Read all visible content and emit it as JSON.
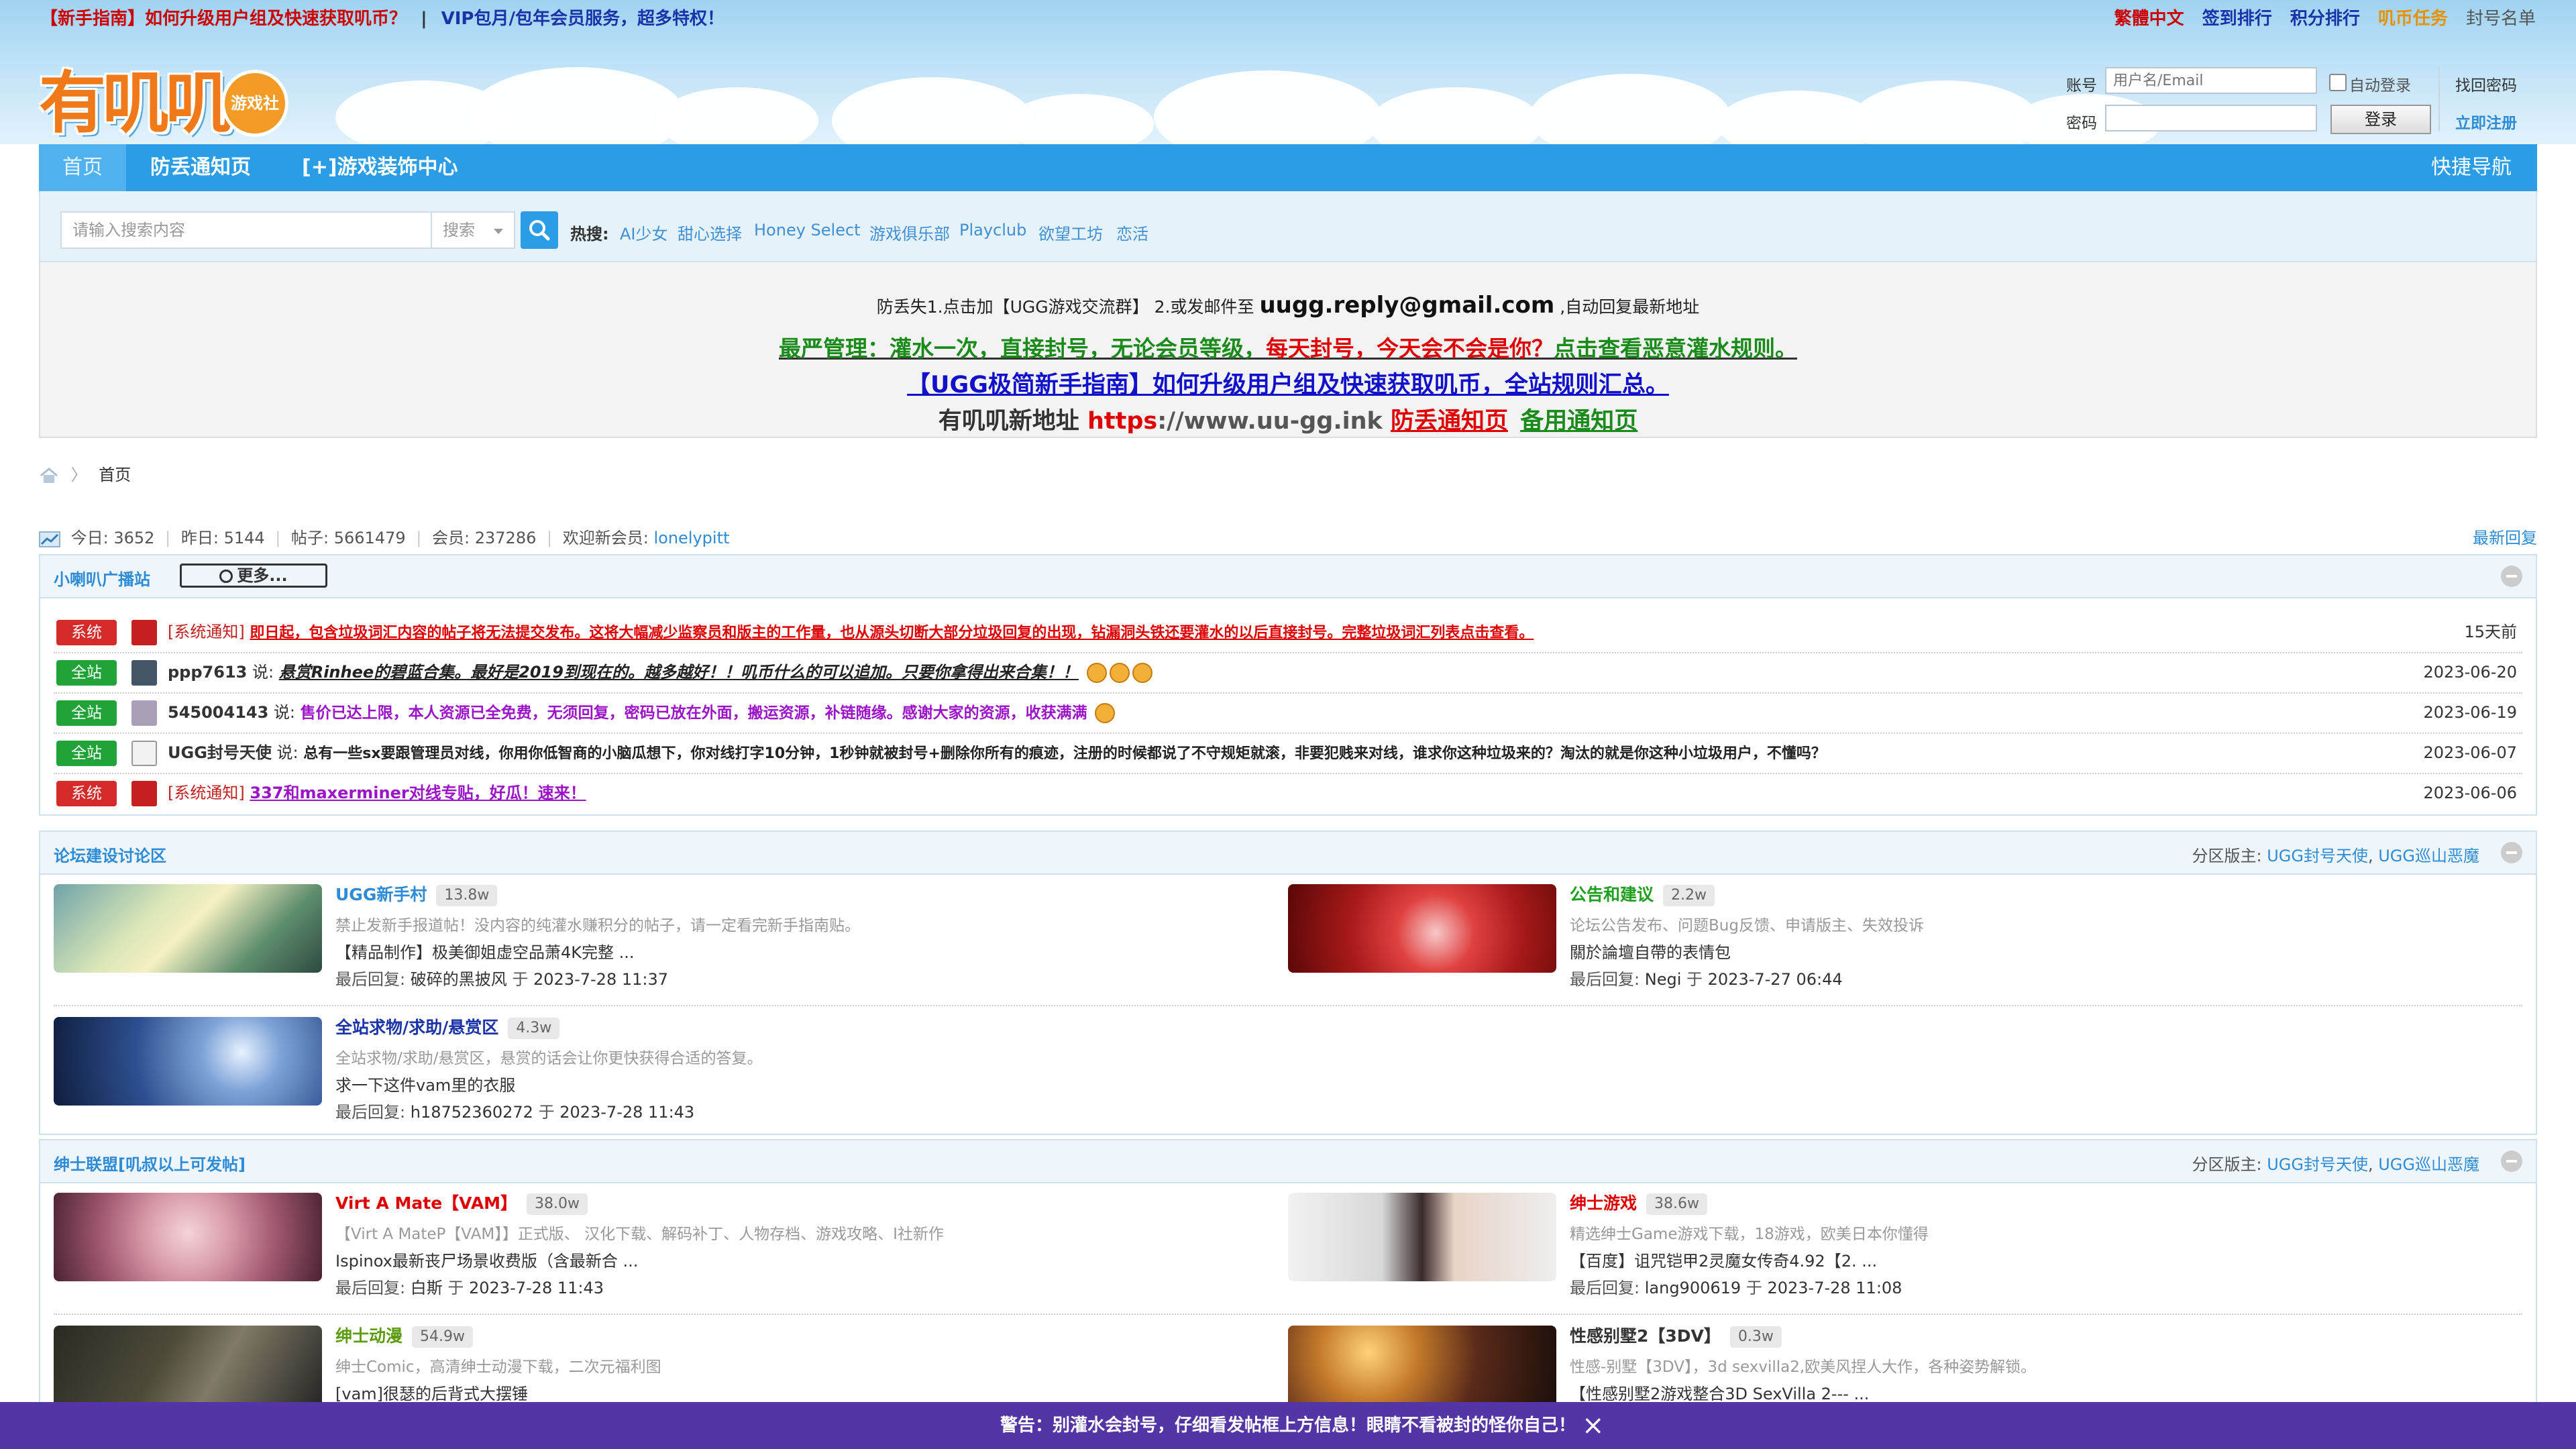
{
  "topbar": {
    "link1": "【新手指南】如何升级用户组及快速获取叽币？",
    "separator": "|",
    "link2": "VIP包月/包年会员服务，超多特权！",
    "right_links": [
      {
        "label": "繁體中文",
        "color": "#cc0000"
      },
      {
        "label": "签到排行",
        "color": "#1b33a8"
      },
      {
        "label": "积分排行",
        "color": "#1b33a8"
      },
      {
        "label": "叽币任务",
        "color": "#e69100"
      },
      {
        "label": "封号名单",
        "color": "#555555"
      }
    ]
  },
  "logo": {
    "text": "有叽叽",
    "badge": "游戏社"
  },
  "login": {
    "account_label": "账号",
    "account_placeholder": "用户名/Email",
    "auto_login": "自动登录",
    "find_password": "找回密码",
    "password_label": "密码",
    "login_button": "登录",
    "register": "立即注册"
  },
  "nav": {
    "items": [
      "首页",
      "防丢通知页",
      "[+]游戏装饰中心"
    ],
    "quick": "快捷导航"
  },
  "search": {
    "placeholder": "请输入搜索内容",
    "select": "搜索",
    "hot_label": "热搜:",
    "hot": [
      "AI少女",
      "甜心选择",
      "Honey Select",
      "游戏俱乐部",
      "Playclub",
      "欲望工坊",
      "恋活"
    ]
  },
  "announce": {
    "line1_pre": "防丢失1.点击加【UGG游戏交流群】 2.或发邮件至",
    "line1_email": "uugg.reply@gmail.com",
    "line1_post": ",自动回复最新地址",
    "line2_a": "最严管理：灌水一次，直接封号，无论会员等级，",
    "line2_b": "每天封号，今天会不会是你？",
    "line2_c": "点击查看恶意灌水规则。",
    "line3": "【UGG极简新手指南】如何升级用户组及快速获取叽币，全站规则汇总。",
    "line4_a": "有叽叽新地址 ",
    "line4_b": "https",
    "line4_c": "://www.uu-gg.ink ",
    "line4_d": "防丢通知页",
    "line4_e": "备用通知页"
  },
  "breadcrumb": {
    "home": "首页"
  },
  "stats": {
    "today_label": "今日:",
    "today": "3652",
    "yesterday_label": "昨日:",
    "yesterday": "5144",
    "posts_label": "帖子:",
    "posts": "5661479",
    "members_label": "会员:",
    "members": "237286",
    "welcome_label": "欢迎新会员:",
    "newest": "lonelypitt",
    "latest_reply": "最新回复"
  },
  "broadcast": {
    "title": "小喇叭广播站",
    "more": "更多...",
    "rows": [
      {
        "tag": "系统",
        "user": "[系统通知]",
        "said": "",
        "text": "即日起，包含垃圾词汇内容的帖子将无法提交发布。这将大幅减少监察员和版主的工作量，也从源头切断大部分垃圾回复的出现，钻漏洞头铁还要灌水的以后直接封号。完整垃圾词汇列表点击查看。",
        "date": "15天前"
      },
      {
        "tag": "全站",
        "user": "ppp7613",
        "said": "说:",
        "text": "悬赏Rinhee的碧蓝合集。最好是2019到现在的。越多越好！！叽币什么的可以追加。只要你拿得出来合集！！",
        "date": "2023-06-20"
      },
      {
        "tag": "全站",
        "user": "545004143",
        "said": "说:",
        "text": "售价已达上限，本人资源已全免费，无须回复，密码已放在外面，搬运资源，补链随缘。感谢大家的资源，收获满满",
        "date": "2023-06-19"
      },
      {
        "tag": "全站",
        "user": "UGG封号天使",
        "said": "说:",
        "text": "总有一些sx要跟管理员对线，你用你低智商的小脑瓜想下，你对线打字10分钟，1秒钟就被封号+删除你所有的痕迹，注册的时候都说了不守规矩就滚，非要犯贱来对线，谁求你这种垃圾来的？淘汰的就是你这种小垃圾用户，不懂吗？",
        "date": "2023-06-07"
      },
      {
        "tag": "系统",
        "user": "[系统通知]",
        "said": "",
        "text": "337和maxerminer对线专贴，好瓜！速来！",
        "date": "2023-06-06"
      }
    ]
  },
  "section1": {
    "title": "论坛建设讨论区",
    "mods_label": "分区版主:",
    "mods": [
      "UGG封号天使",
      "UGG巡山恶魔"
    ],
    "forums": [
      {
        "name": "UGG新手村",
        "count": "13.8w",
        "desc": "禁止发新手报道帖！没内容的纯灌水赚积分的帖子，请一定看完新手指南贴。",
        "last": "【精品制作】极美御姐虚空品萧4K完整 ...",
        "last_reply_label": "最后回复:",
        "last_user": "破碎的黑披风",
        "at": "于",
        "time": "2023-7-28 11:37"
      },
      {
        "name": "公告和建议",
        "count": "2.2w",
        "desc": "论坛公告发布、问题Bug反馈、申请版主、失效投诉",
        "last": "關於論壇自帶的表情包",
        "last_reply_label": "最后回复:",
        "last_user": "Negi",
        "at": "于",
        "time": "2023-7-27 06:44"
      },
      {
        "name": "全站求物/求助/悬赏区",
        "count": "4.3w",
        "desc": "全站求物/求助/悬赏区，悬赏的话会让你更快获得合适的答复。",
        "last": "求一下这件vam里的衣服",
        "last_reply_label": "最后回复:",
        "last_user": "h18752360272",
        "at": "于",
        "time": "2023-7-28 11:43"
      }
    ]
  },
  "section2": {
    "title": "绅士联盟[叽叔以上可发帖]",
    "mods_label": "分区版主:",
    "mods": [
      "UGG封号天使",
      "UGG巡山恶魔"
    ],
    "forums": [
      {
        "name": "Virt A Mate【VAM】",
        "count": "38.0w",
        "desc": "【Virt A MateP【VAM】】正式版、 汉化下载、解码补丁、人物存档、游戏攻略、I社新作",
        "last": "Ispinox最新丧尸场景收费版（含最新合 ...",
        "last_reply_label": "最后回复:",
        "last_user": "白斯",
        "at": "于",
        "time": "2023-7-28 11:43"
      },
      {
        "name": "绅士游戏",
        "count": "38.6w",
        "desc": "精选绅士Game游戏下载，18游戏，欧美日本你懂得",
        "last": "【百度】诅咒铠甲2灵魔女传奇4.92【2. ...",
        "last_reply_label": "最后回复:",
        "last_user": "lang900619",
        "at": "于",
        "time": "2023-7-28 11:08"
      },
      {
        "name": "绅士动漫",
        "count": "54.9w",
        "desc": "绅士Comic，高清绅士动漫下载，二次元福利图",
        "last": "[vam]很瑟的后背式大摆锤",
        "last_reply_label": "",
        "last_user": "",
        "at": "",
        "time": ""
      },
      {
        "name": "性感别墅2【3DV】",
        "count": "0.3w",
        "desc": "性感-别墅【3DV】，3d sexvilla2,欧美风捏人大作，各种姿势解锁。",
        "last": "【性感别墅2游戏整合3D SexVilla 2--- ...",
        "last_reply_label": "",
        "last_user": "",
        "at": "",
        "time": ""
      }
    ]
  },
  "warning": {
    "text": "警告：别灌水会封号，仔细看发帖框上方信息！眼睛不看被封的怪你自己！",
    "close": "×"
  },
  "colors": {
    "nav": "#2b9de7",
    "link": "#2e8bd6",
    "system_tag": "#d42a2a",
    "site_tag": "#22a33a",
    "warning_bar": "#5335a6"
  }
}
